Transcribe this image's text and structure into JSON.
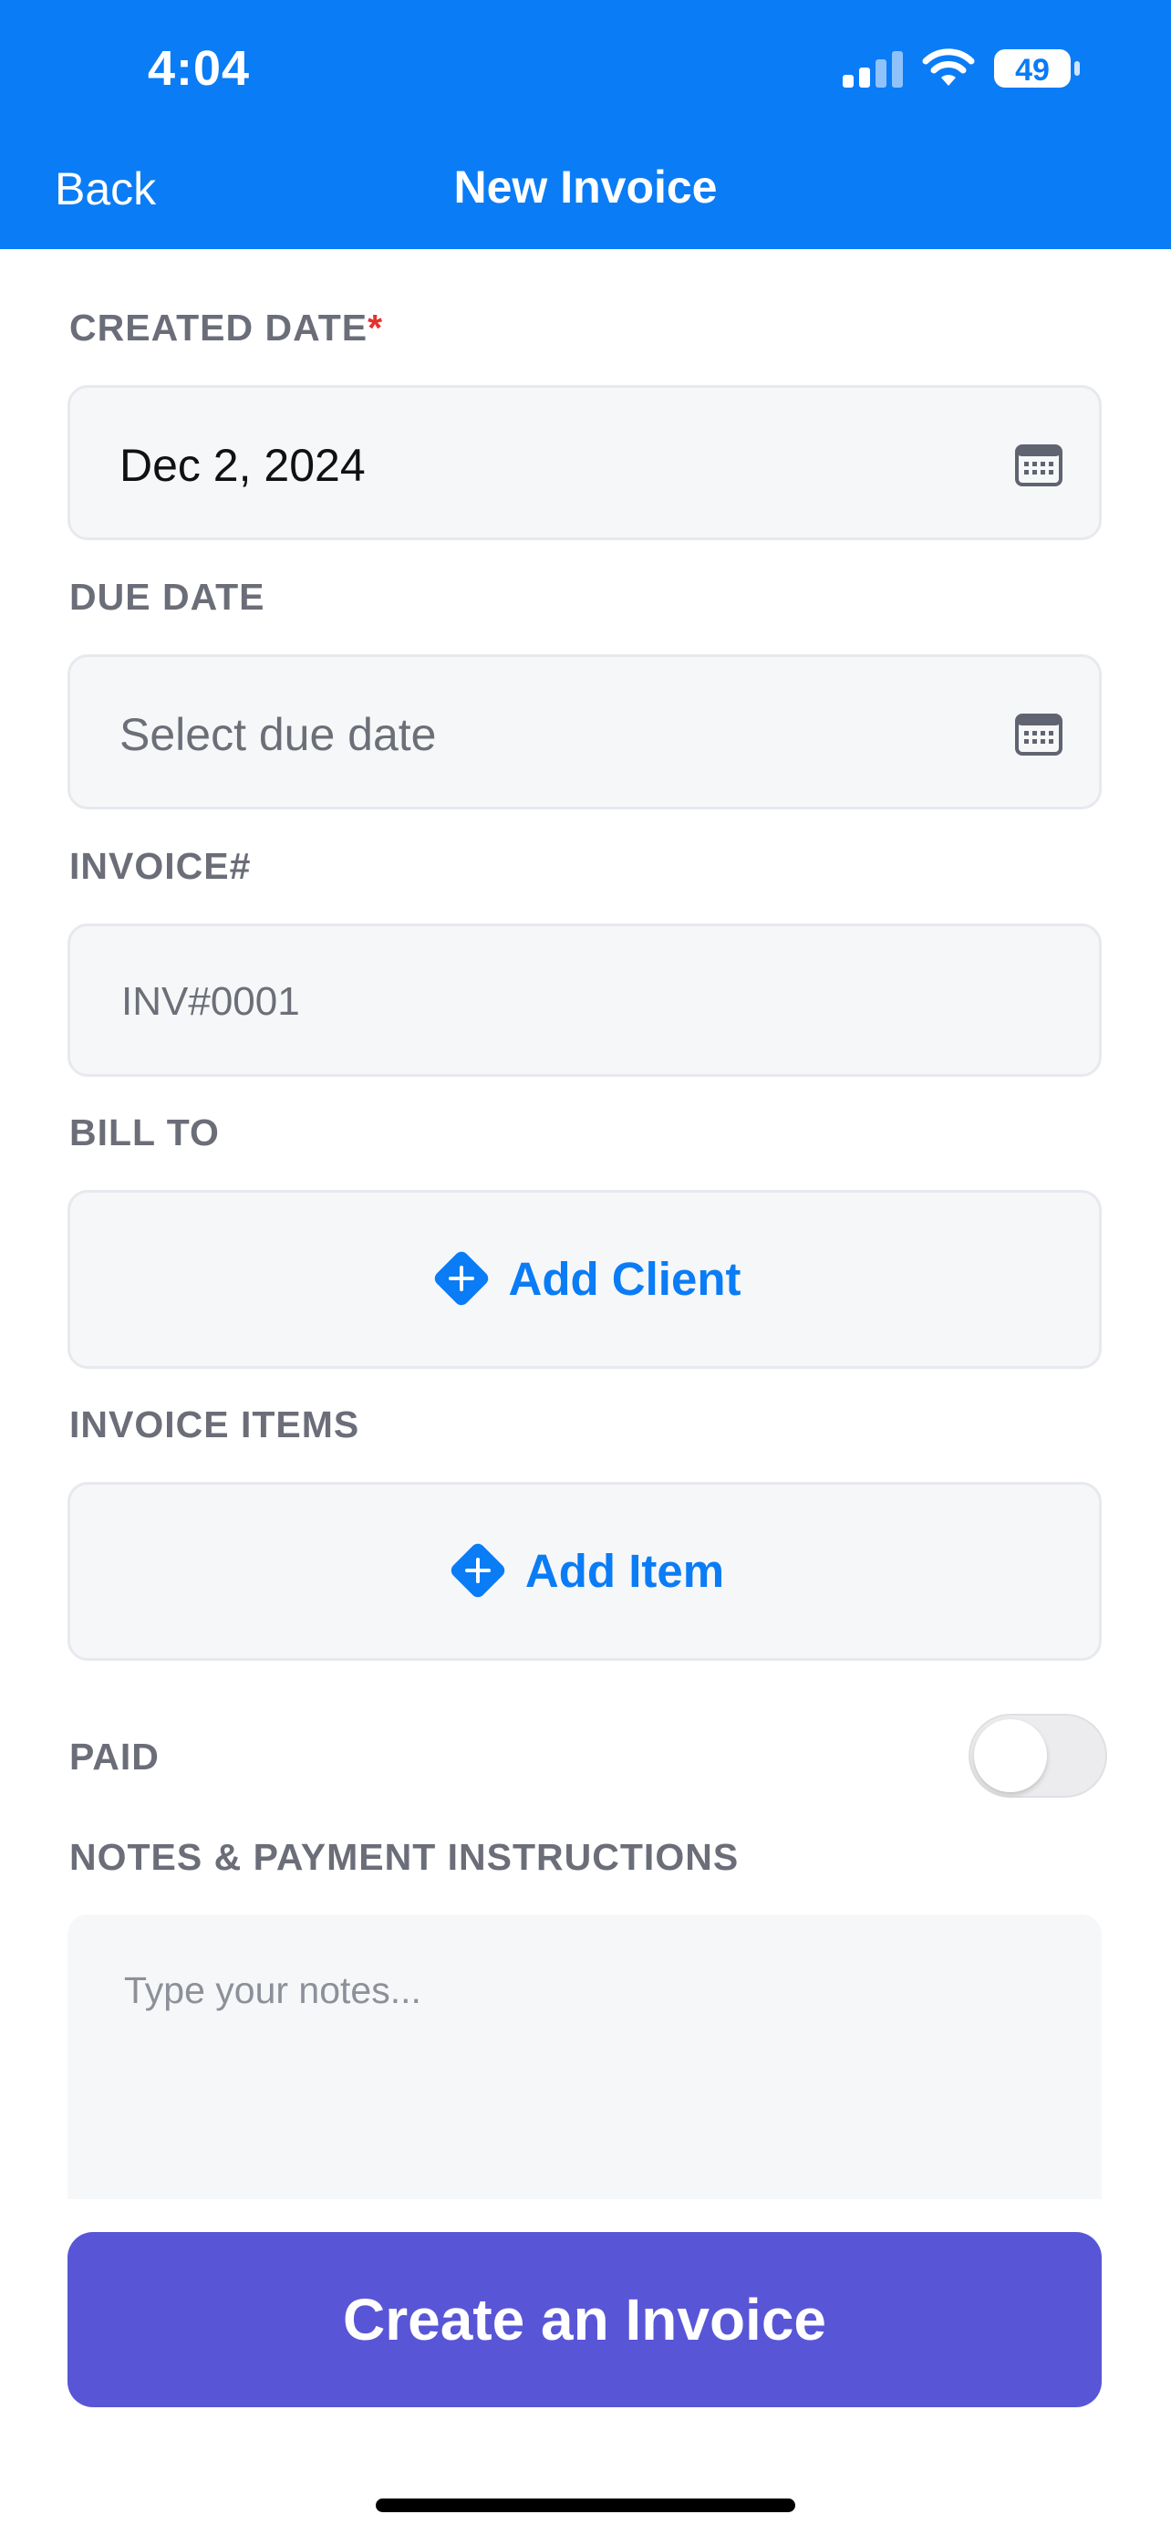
{
  "status_bar": {
    "time": "4:04",
    "battery": "49"
  },
  "nav": {
    "back_label": "Back",
    "title": "New Invoice"
  },
  "form": {
    "created_date": {
      "label": "CREATED DATE",
      "required_mark": "*",
      "value": "Dec 2, 2024",
      "icon": "calendar-icon"
    },
    "due_date": {
      "label": "DUE DATE",
      "placeholder": "Select due date",
      "icon": "calendar-icon"
    },
    "invoice_number": {
      "label": "INVOICE#",
      "value": "INV#0001"
    },
    "bill_to": {
      "label": "BILL TO",
      "button_label": "Add Client",
      "icon": "plus-diamond-icon"
    },
    "invoice_items": {
      "label": "INVOICE ITEMS",
      "button_label": "Add Item",
      "icon": "plus-diamond-icon"
    },
    "paid": {
      "label": "PAID",
      "toggle_on": false
    },
    "notes": {
      "label": "NOTES & PAYMENT INSTRUCTIONS",
      "placeholder": "Type your notes..."
    }
  },
  "actions": {
    "create_label": "Create an Invoice"
  },
  "colors": {
    "header_blue": "#0a7cf6",
    "accent_blue": "#0a7cf6",
    "cta_purple": "#5856d6",
    "required_red": "#e5322d"
  }
}
